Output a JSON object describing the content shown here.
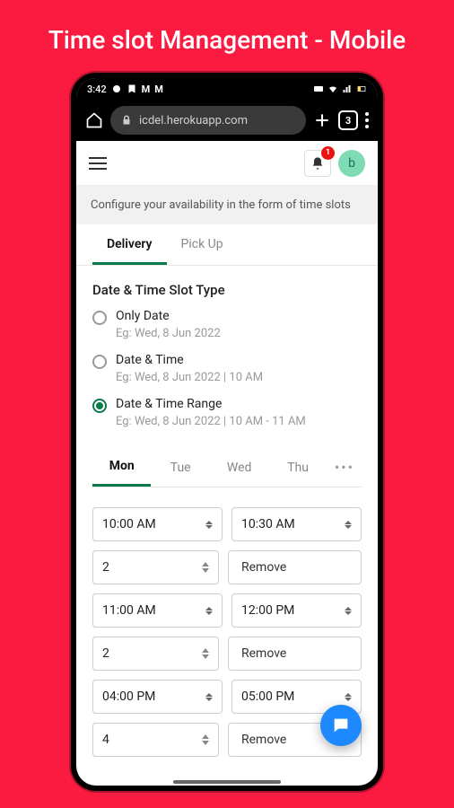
{
  "page_title": "Time slot Management - Mobile",
  "status": {
    "time": "3:42"
  },
  "browser": {
    "url": "icdel.herokuapp.com",
    "tab_count": "3"
  },
  "header": {
    "badge": "1",
    "avatar": "b"
  },
  "info_text": "Configure your availability in the form of time slots",
  "main_tabs": [
    {
      "label": "Delivery",
      "active": true
    },
    {
      "label": "Pick Up",
      "active": false
    }
  ],
  "section_title": "Date & Time Slot Type",
  "radio_options": [
    {
      "label": "Only Date",
      "eg": "Eg: Wed, 8 Jun 2022",
      "selected": false
    },
    {
      "label": "Date & Time",
      "eg": "Eg: Wed, 8 Jun 2022 | 10 AM",
      "selected": false
    },
    {
      "label": "Date & Time Range",
      "eg": "Eg: Wed, 8 Jun 2022 | 10 AM - 11 AM",
      "selected": true
    }
  ],
  "day_tabs": [
    {
      "label": "Mon",
      "active": true
    },
    {
      "label": "Tue",
      "active": false
    },
    {
      "label": "Wed",
      "active": false
    },
    {
      "label": "Thu",
      "active": false
    }
  ],
  "slots": [
    {
      "start": "10:00 AM",
      "end": "10:30 AM",
      "qty": "2",
      "action": "Remove"
    },
    {
      "start": "11:00 AM",
      "end": "12:00 PM",
      "qty": "2",
      "action": "Remove"
    },
    {
      "start": "04:00 PM",
      "end": "05:00 PM",
      "qty": "4",
      "action": "Remove"
    }
  ]
}
